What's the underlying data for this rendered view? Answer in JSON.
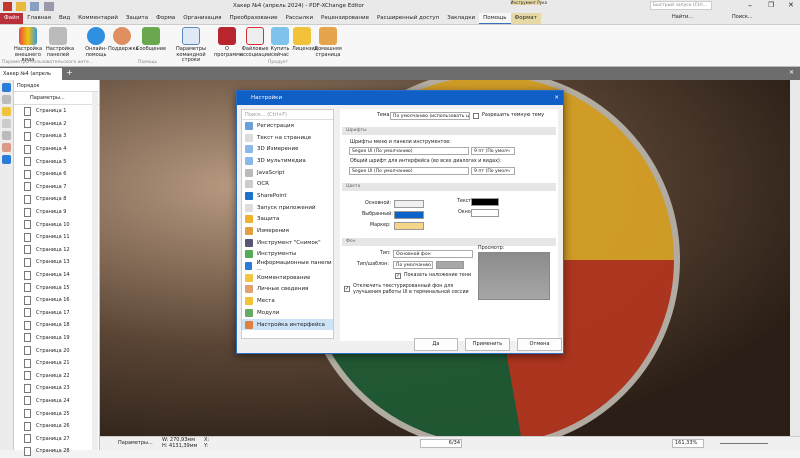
{
  "window": {
    "title": "Хакер №4 (апрель 2024) - PDF-XChange Editor",
    "quick_launch_placeholder": "Быстрый запуск (Ctrl...",
    "find": "Найти...",
    "search": "Поиск..."
  },
  "menu_tabs": [
    "Файл",
    "Главная",
    "Вид",
    "Комментарий",
    "Защита",
    "Форма",
    "Организация",
    "Преобразование",
    "Рассылки",
    "Рецензирование",
    "Расширенный доступ",
    "Закладки",
    "Помощь",
    "Формат"
  ],
  "context_tab_group": "Инструмент Рука",
  "ribbon": {
    "buttons": [
      "Настройка внешнего вида",
      "Настройка панелей",
      "Онлайн-помощь",
      "Поддержка",
      "Сообщение",
      "Параметры командной строки",
      "О программе",
      "Файловые ассоциации",
      "Купить сейчас",
      "Лицензия",
      "Домашняя страница"
    ],
    "groups": [
      "Параметры пользовательского инте...",
      "Помощь",
      "Продукт"
    ]
  },
  "doc_tab": "Хакер №4 (апрель 2024)",
  "panel": {
    "title": "Порядок",
    "options": "Параметры...",
    "pages": [
      "Страница 1",
      "Страница 2",
      "Страница 3",
      "Страница 4",
      "Страница 5",
      "Страница 6",
      "Страница 7",
      "Страница 8",
      "Страница 9",
      "Страница 10",
      "Страница 11",
      "Страница 12",
      "Страница 13",
      "Страница 14",
      "Страница 15",
      "Страница 16",
      "Страница 17",
      "Страница 18",
      "Страница 19",
      "Страница 20",
      "Страница 21",
      "Страница 22",
      "Страница 23",
      "Страница 24",
      "Страница 25",
      "Страница 26",
      "Страница 27",
      "Страница 28"
    ]
  },
  "status": {
    "options": "Параметры...",
    "w": "W: 270,93мм",
    "h": "H: 4131,39мм",
    "x": "X:",
    "y": "Y:",
    "page": "6",
    "pages": "/34",
    "zoom": "161,33%"
  },
  "dialog": {
    "title": "Настройки",
    "search_placeholder": "Поиск... (Ctrl+F)",
    "items": [
      "Регистрация",
      "Текст на странице",
      "3D Измерение",
      "3D мультимедиа",
      "JavaScript",
      "OCR",
      "SharePoint",
      "Запуск приложений",
      "Защита",
      "Измерения",
      "Инструмент \"Снимок\"",
      "Инструменты",
      "Информационные панели ...",
      "Комментирование",
      "Личные сведения",
      "Места",
      "Модули",
      "Настройка интерфейса"
    ],
    "theme_label": "Тема:",
    "theme_value": "По умолчанию (использовать цвет с",
    "dark_theme": "Разрешить темную тему",
    "fonts_section": "Шрифты",
    "menu_font_label": "Шрифты меню и панели инструментов:",
    "menu_font": "Segoe UI (По умолчанию)",
    "menu_size": "9 пт (По умолч",
    "ui_font_label": "Общий шрифт для интерфейса (во всех диалогах и видах):",
    "ui_font": "Segoe UI (По умолчанию)",
    "ui_size": "9 пт (По умолч",
    "colors_section": "Цвета",
    "main_label": "Основной:",
    "selected_label": "Выбранный:",
    "marker_label": "Маркер:",
    "text_label": "Текст:",
    "window_label": "Окно:",
    "colors": {
      "main": "#f0f0f0",
      "selected": "#0a64c8",
      "marker": "#f5d58a",
      "text": "#000000",
      "window": "#ffffff"
    },
    "bg_section": "Фон",
    "type_label": "Тип:",
    "type_value": "Основной фон",
    "pattern_label": "Тип/шаблон:",
    "pattern_value": "По умолчанию",
    "shadow": "Показать наложение тени",
    "disable_texture": "Отключить текстурированный фон для улучшения работы UI в терминальной сессии",
    "preview": "Просмотр:",
    "ok": "Да",
    "apply": "Применить",
    "cancel": "Отмена"
  }
}
